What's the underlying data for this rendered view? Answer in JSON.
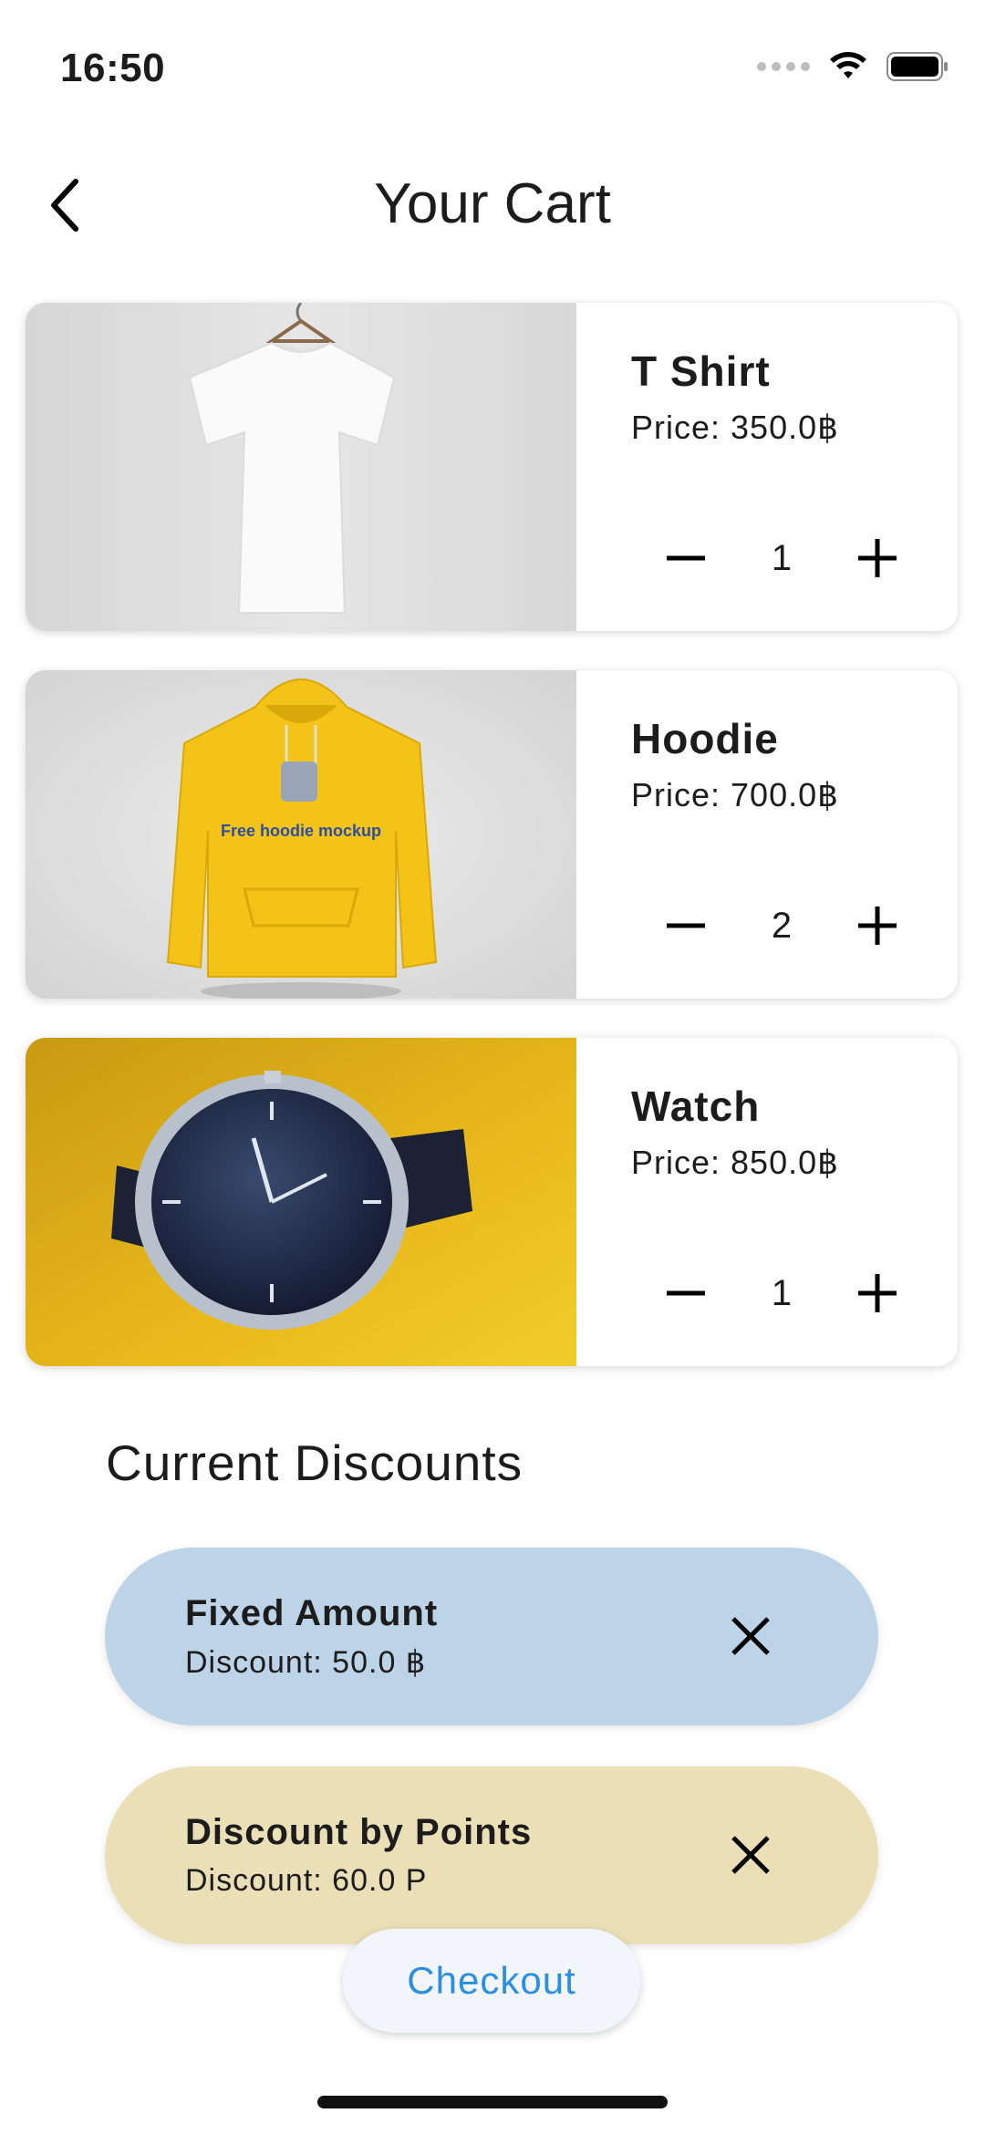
{
  "status": {
    "time": "16:50"
  },
  "header": {
    "title": "Your Cart"
  },
  "cart": {
    "items": [
      {
        "name": "T Shirt",
        "price": "Price: 350.0฿",
        "quantity": "1",
        "image": "tshirt-photo"
      },
      {
        "name": "Hoodie",
        "price": "Price: 700.0฿",
        "quantity": "2",
        "image": "hoodie-photo",
        "image_text": "Free hoodie mockup"
      },
      {
        "name": "Watch",
        "price": "Price: 850.0฿",
        "quantity": "1",
        "image": "watch-photo"
      }
    ]
  },
  "discounts": {
    "title": "Current Discounts",
    "items": [
      {
        "title": "Fixed Amount",
        "subtitle": "Discount: 50.0 ฿",
        "color": "#bcd3e8"
      },
      {
        "title": "Discount by Points",
        "subtitle": "Discount: 60.0 P",
        "color": "#ebdfb8"
      }
    ]
  },
  "checkout": {
    "label": "Checkout",
    "color": "#2a8fe0"
  }
}
